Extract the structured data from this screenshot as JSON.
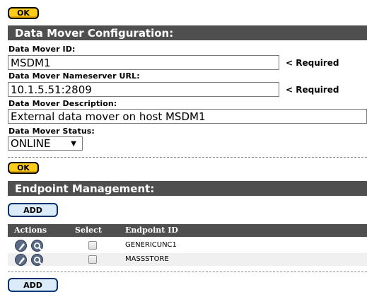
{
  "buttons": {
    "ok_top": "OK",
    "ok_bottom": "OK",
    "add_top": "ADD",
    "add_bottom": "ADD"
  },
  "config": {
    "title": "Data Mover Configuration:",
    "id_label": "Data Mover ID:",
    "id_value": "MSDM1",
    "url_label": "Data Mover Nameserver URL:",
    "url_value": "10.1.5.51:2809",
    "desc_label": "Data Mover Description:",
    "desc_value": "External data mover on host MSDM1",
    "status_label": "Data Mover Status:",
    "status_value": "ONLINE",
    "required_text": "< Required"
  },
  "endpoints": {
    "title": "Endpoint Management:",
    "columns": [
      "Actions",
      "Select",
      "Endpoint ID"
    ],
    "rows": [
      {
        "endpoint_id": "GENERICUNC1"
      },
      {
        "endpoint_id": "MASSSTORE"
      }
    ]
  },
  "icons": {
    "edit": "edit-icon",
    "view": "view-icon",
    "dropdown": "chevron-down-icon"
  }
}
